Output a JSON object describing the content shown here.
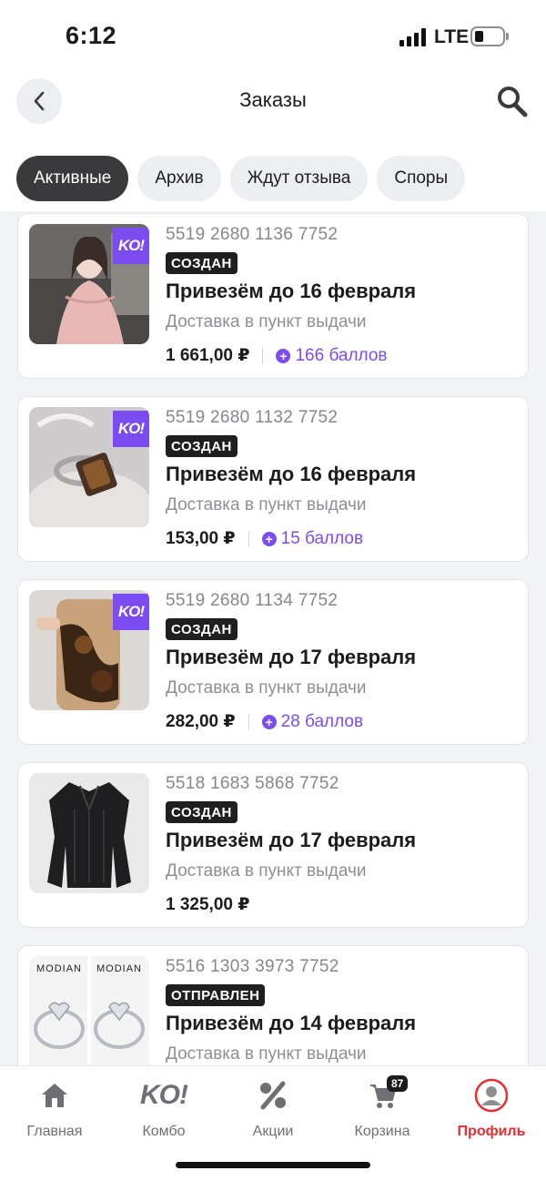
{
  "status_bar": {
    "time": "6:12",
    "network": "LTE"
  },
  "header": {
    "title": "Заказы"
  },
  "tabs": [
    {
      "label": "Активные",
      "active": true
    },
    {
      "label": "Архив",
      "active": false
    },
    {
      "label": "Ждут отзыва",
      "active": false
    },
    {
      "label": "Споры",
      "active": false
    }
  ],
  "orders": [
    {
      "number": "5519 2680 1136 7752",
      "status": "СОЗДАН",
      "date": "Привезём до 16 февраля",
      "delivery": "Доставка в пункт выдачи",
      "price": "1 661,00 ₽",
      "points": "166 баллов",
      "badge": "KO!"
    },
    {
      "number": "5519 2680 1132 7752",
      "status": "СОЗДАН",
      "date": "Привезём до 16 февраля",
      "delivery": "Доставка в пункт выдачи",
      "price": "153,00 ₽",
      "points": "15 баллов",
      "badge": "KO!"
    },
    {
      "number": "5519 2680 1134 7752",
      "status": "СОЗДАН",
      "date": "Привезём до 17 февраля",
      "delivery": "Доставка в пункт выдачи",
      "price": "282,00 ₽",
      "points": "28 баллов",
      "badge": "KO!"
    },
    {
      "number": "5518 1683 5868 7752",
      "status": "СОЗДАН",
      "date": "Привезём до 17 февраля",
      "delivery": "Доставка в пункт выдачи",
      "price": "1 325,00 ₽"
    },
    {
      "number": "5516 1303 3973 7752",
      "status": "ОТПРАВЛЕН",
      "date": "Привезём до 14 февраля",
      "delivery": "Доставка в пункт выдачи",
      "brand": "MODIAN"
    }
  ],
  "bottom_nav": [
    {
      "label": "Главная",
      "icon": "home-icon"
    },
    {
      "label": "Комбо",
      "icon": "ko-logo-icon",
      "logo_text": "KO!"
    },
    {
      "label": "Акции",
      "icon": "percent-icon"
    },
    {
      "label": "Корзина",
      "icon": "cart-icon",
      "count": "87"
    },
    {
      "label": "Профиль",
      "icon": "profile-icon",
      "active": true
    }
  ],
  "colors": {
    "accent": "#7b4df1",
    "active_nav": "#e62e2e",
    "tab_active": "#3a3a3c"
  }
}
